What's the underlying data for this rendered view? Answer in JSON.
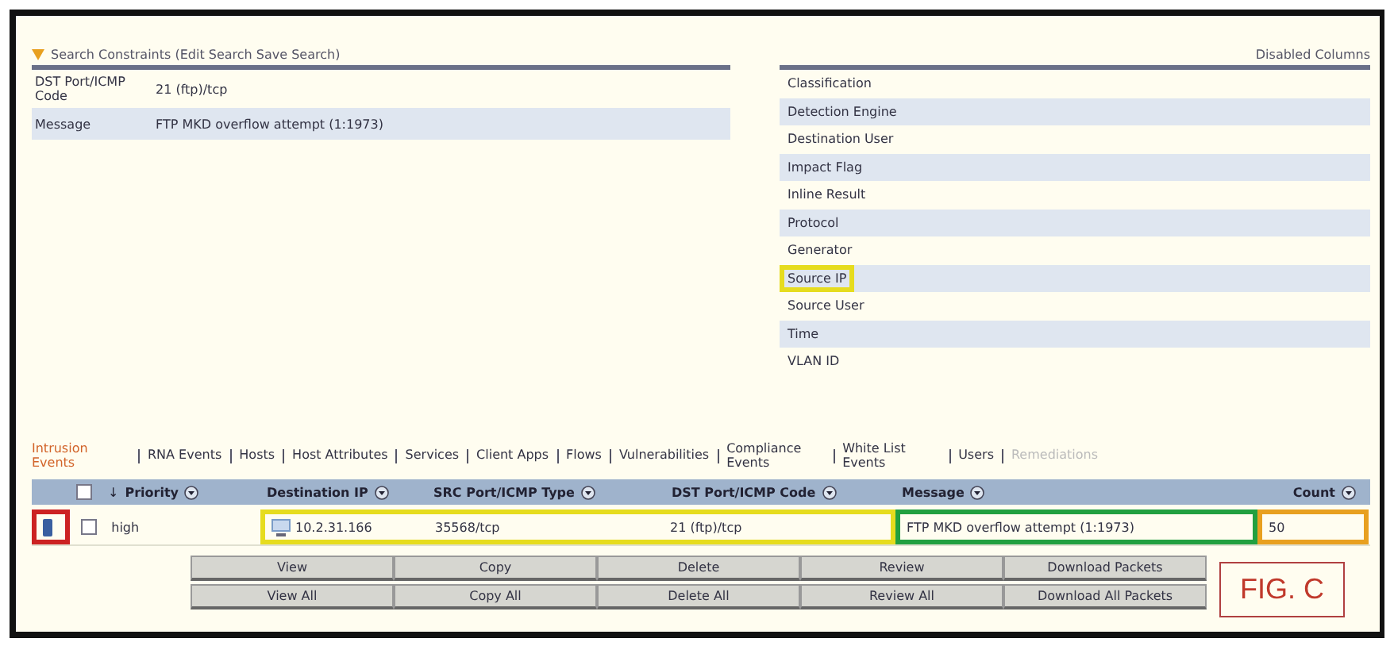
{
  "search_constraints": {
    "title": "Search Constraints (Edit Search Save Search)",
    "rows": [
      {
        "label": "DST Port/ICMP Code",
        "value": "21 (ftp)/tcp"
      },
      {
        "label": "Message",
        "value": "FTP MKD overflow attempt (1:1973)"
      }
    ]
  },
  "disabled_columns": {
    "title": "Disabled Columns",
    "items": [
      {
        "label": "Classification"
      },
      {
        "label": "Detection Engine"
      },
      {
        "label": "Destination User"
      },
      {
        "label": "Impact Flag"
      },
      {
        "label": "Inline Result"
      },
      {
        "label": "Protocol"
      },
      {
        "label": "Generator"
      },
      {
        "label": "Source IP",
        "color": "#e6dc1e"
      },
      {
        "label": "Source User"
      },
      {
        "label": "Time"
      },
      {
        "label": "VLAN ID"
      }
    ]
  },
  "tabs": [
    {
      "label": "Intrusion Events",
      "selected": true,
      "disabled": false
    },
    {
      "label": "RNA Events",
      "selected": false,
      "disabled": false
    },
    {
      "label": "Hosts",
      "selected": false,
      "disabled": false
    },
    {
      "label": "Host Attributes",
      "selected": false,
      "disabled": false
    },
    {
      "label": "Services",
      "selected": false,
      "disabled": false
    },
    {
      "label": "Client Apps",
      "selected": false,
      "disabled": false
    },
    {
      "label": "Flows",
      "selected": false,
      "disabled": false
    },
    {
      "label": "Vulnerabilities",
      "selected": false,
      "disabled": false
    },
    {
      "label": "Compliance Events",
      "selected": false,
      "disabled": false
    },
    {
      "label": "White List Events",
      "selected": false,
      "disabled": false
    },
    {
      "label": "Users",
      "selected": false,
      "disabled": false
    },
    {
      "label": "Remediations",
      "selected": false,
      "disabled": true
    }
  ],
  "table": {
    "header_checkbox": {
      "checked": false
    },
    "columns": [
      {
        "label": "Priority",
        "sort": "↓"
      },
      {
        "label": "Destination IP"
      },
      {
        "label": "SRC Port/ICMP Type"
      },
      {
        "label": "DST Port/ICMP Code"
      },
      {
        "label": "Message"
      },
      {
        "label": "Count"
      }
    ],
    "row": {
      "groups": [
        {
          "color": "#cc2222",
          "cells": [
            {
              "kind": "marker"
            }
          ]
        },
        {
          "cells": [
            {
              "kind": "checkbox",
              "checked": false
            },
            {
              "kind": "text",
              "text": "high"
            }
          ]
        },
        {
          "color": "#e6dc1e",
          "cells": [
            {
              "kind": "host",
              "text": "10.2.31.166"
            },
            {
              "kind": "text",
              "text": "35568/tcp"
            },
            {
              "kind": "text",
              "text": "21 (ftp)/tcp"
            }
          ]
        },
        {
          "color": "#22a040",
          "cells": [
            {
              "kind": "text",
              "text": "FTP MKD overflow attempt (1:1973)"
            }
          ]
        },
        {
          "color": "#e8a020",
          "cells": [
            {
              "kind": "text",
              "text": "50"
            }
          ]
        }
      ]
    }
  },
  "buttons": [
    [
      "View",
      "Copy",
      "Delete",
      "Review",
      "Download Packets"
    ],
    [
      "View All",
      "Copy All",
      "Delete All",
      "Review All",
      "Download All Packets"
    ]
  ],
  "figure_label": "FIG. C"
}
